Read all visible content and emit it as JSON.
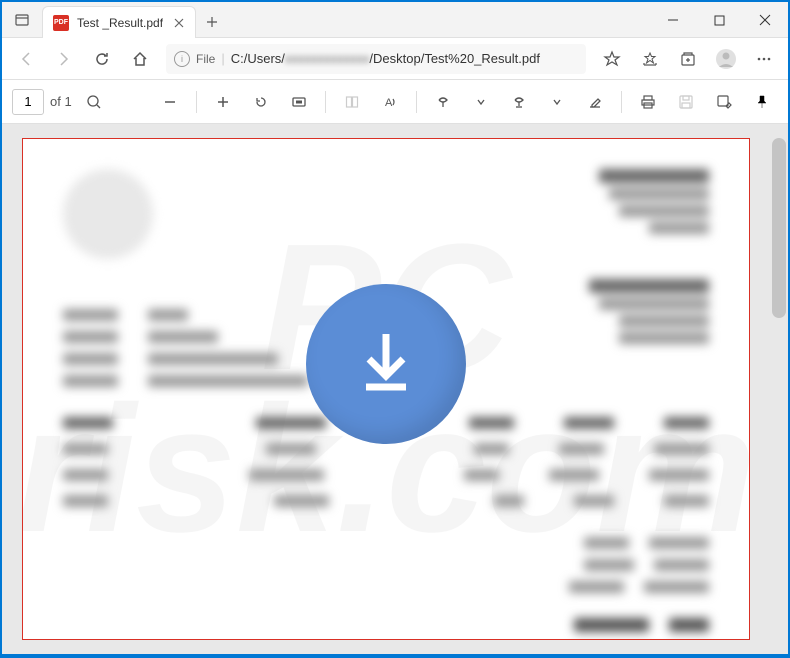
{
  "window": {
    "tab_title": "Test _Result.pdf",
    "tab_icon_label": "PDF"
  },
  "address": {
    "file_label": "File",
    "path_prefix": "C:/Users/",
    "path_blur": "xxxxxxxxxxxxx",
    "path_suffix": "/Desktop/Test%20_Result.pdf"
  },
  "pdf_toolbar": {
    "page_current": "1",
    "page_of": "of 1"
  }
}
